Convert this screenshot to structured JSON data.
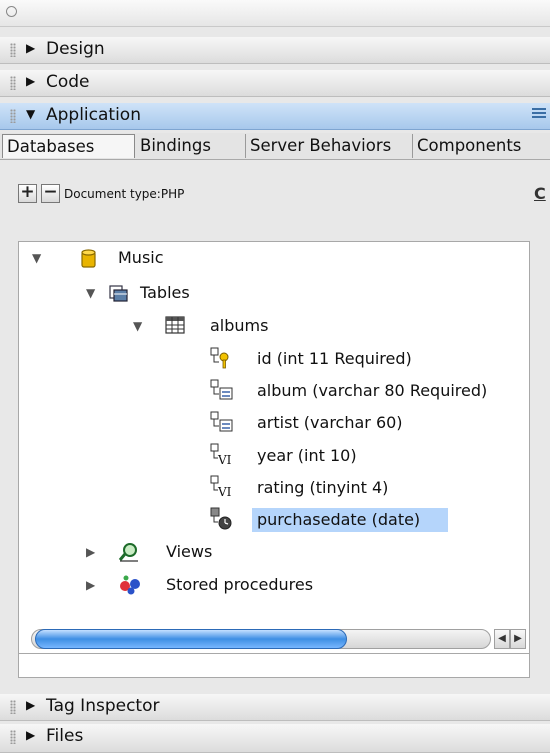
{
  "panels": {
    "design": "Design",
    "code": "Code",
    "application": "Application",
    "tag_inspector": "Tag Inspector",
    "files": "Files"
  },
  "tabs": [
    "Databases",
    "Bindings",
    "Server Behaviors",
    "Components"
  ],
  "toolbar": {
    "add": "+",
    "remove": "−",
    "doc_type": "Document type:PHP",
    "right_letter": "C"
  },
  "tree": {
    "connection": "Music",
    "tables": "Tables",
    "table": "albums",
    "columns": [
      {
        "text": "id (int 11 Required)",
        "icon": "key-column-icon"
      },
      {
        "text": "album (varchar 80 Required)",
        "icon": "text-column-icon"
      },
      {
        "text": "artist (varchar 60)",
        "icon": "text-column-icon"
      },
      {
        "text": "year (int 10)",
        "icon": "numeric-column-icon"
      },
      {
        "text": "rating (tinyint 4)",
        "icon": "numeric-column-icon"
      },
      {
        "text": "purchasedate (date)",
        "icon": "date-column-icon",
        "selected": true
      }
    ],
    "views": "Views",
    "procedures": "Stored procedures"
  },
  "colors": {
    "selection": "#b5d5fb",
    "active_panel": "#a7c8ec"
  }
}
